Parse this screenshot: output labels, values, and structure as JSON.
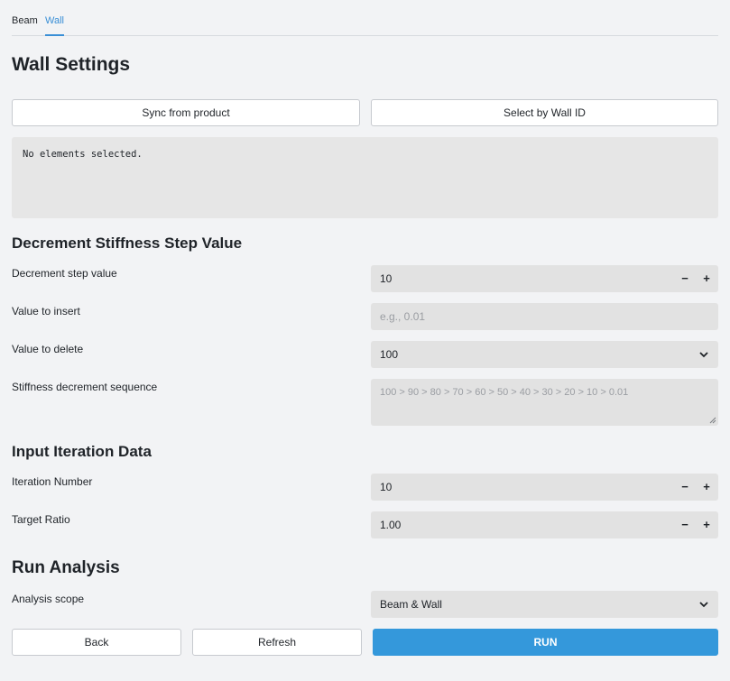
{
  "tabs": {
    "beam": "Beam",
    "wall": "Wall",
    "active": "Wall"
  },
  "title": "Wall Settings",
  "buttons": {
    "sync": "Sync from product",
    "select_wall": "Select by Wall ID"
  },
  "console_text": "No elements selected.",
  "decrement": {
    "heading": "Decrement Stiffness Step Value",
    "step_label": "Decrement step value",
    "step_value": "10",
    "insert_label": "Value to insert",
    "insert_placeholder": "e.g., 0.01",
    "delete_label": "Value to delete",
    "delete_value": "100",
    "sequence_label": "Stiffness decrement sequence",
    "sequence_value": "100 > 90 > 80 > 70 > 60 > 50 > 40 > 30 > 20 > 10 > 0.01"
  },
  "iteration": {
    "heading": "Input Iteration Data",
    "number_label": "Iteration Number",
    "number_value": "10",
    "ratio_label": "Target Ratio",
    "ratio_value": "1.00"
  },
  "run": {
    "heading": "Run Analysis",
    "scope_label": "Analysis scope",
    "scope_value": "Beam & Wall",
    "back": "Back",
    "refresh": "Refresh",
    "run": "RUN"
  },
  "stepper": {
    "minus": "−",
    "plus": "+"
  },
  "colors": {
    "accent": "#3498db",
    "background": "#f2f3f5",
    "field": "#e2e2e2"
  }
}
